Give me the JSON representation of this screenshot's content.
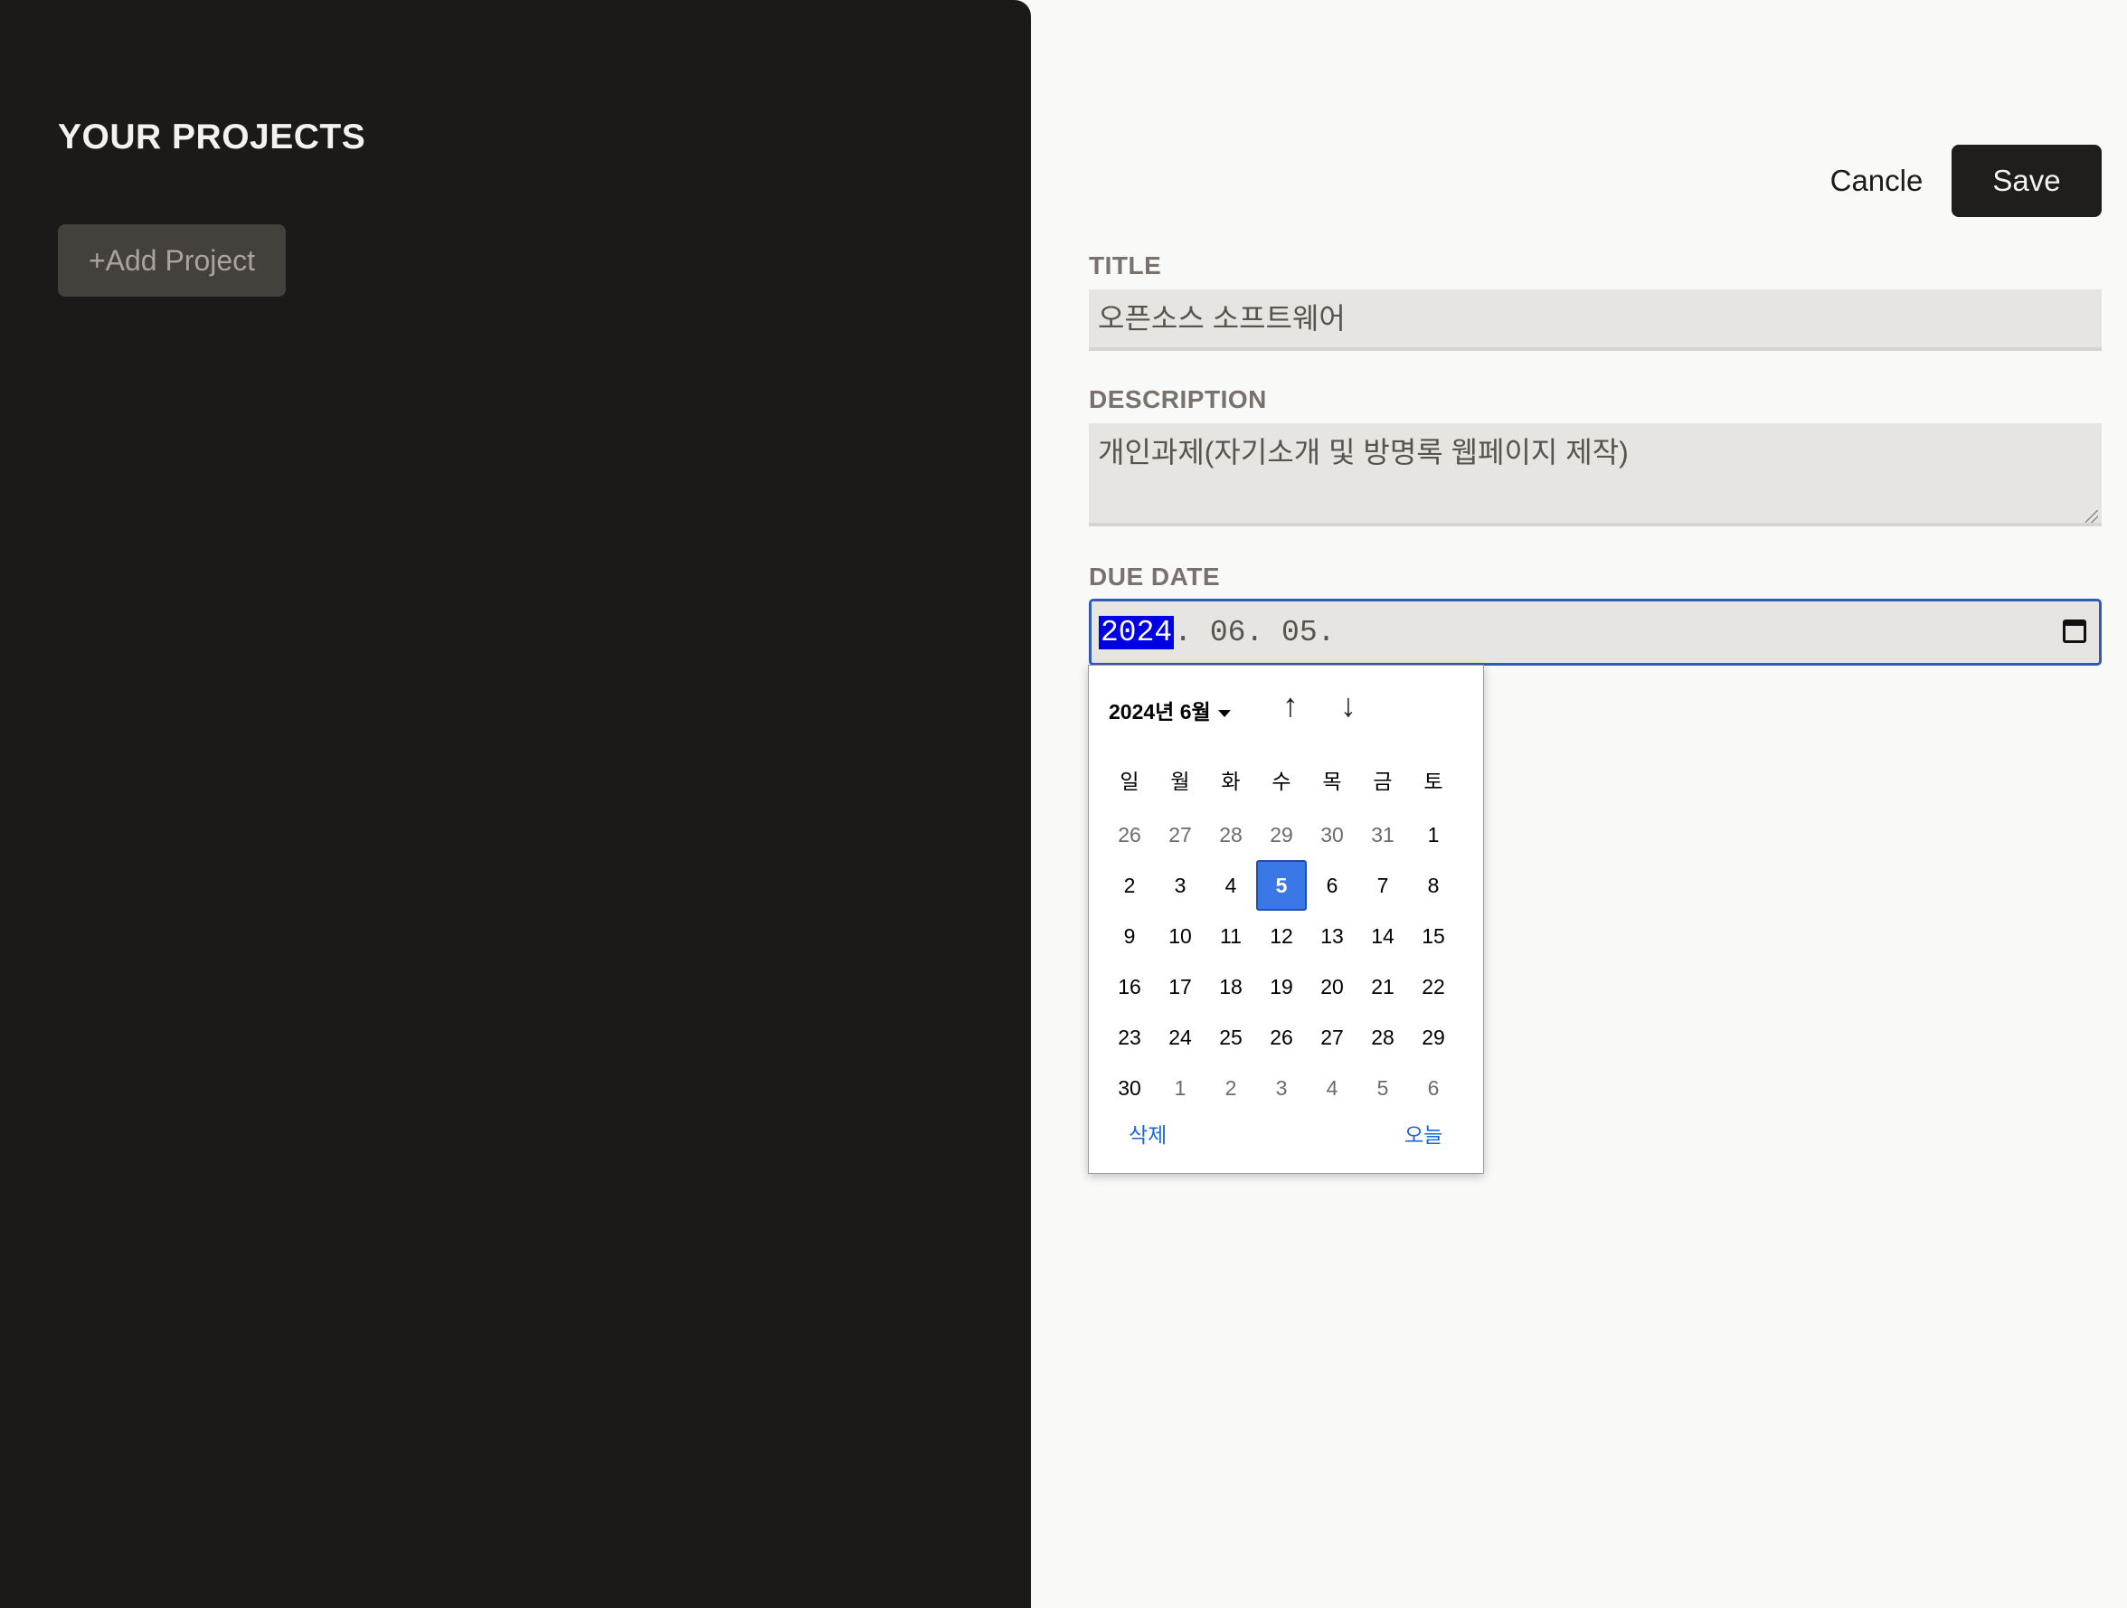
{
  "sidebar": {
    "title": "YOUR PROJECTS",
    "add_button": "+Add Project"
  },
  "actions": {
    "cancel_label": "Cancle",
    "save_label": "Save"
  },
  "form": {
    "title_label": "TITLE",
    "title_value": "오픈소스 소프트웨어",
    "description_label": "DESCRIPTION",
    "description_value": "개인과제(자기소개 및 방명록 웹페이지 제작)",
    "due_date_label": "DUE DATE",
    "due_date_year": "2024",
    "due_date_rest": ". 06. 05."
  },
  "calendar": {
    "month_label": "2024년 6월",
    "weekdays": [
      "일",
      "월",
      "화",
      "수",
      "목",
      "금",
      "토"
    ],
    "weeks": [
      [
        "26",
        "27",
        "28",
        "29",
        "30",
        "31",
        "1"
      ],
      [
        "2",
        "3",
        "4",
        "5",
        "6",
        "7",
        "8"
      ],
      [
        "9",
        "10",
        "11",
        "12",
        "13",
        "14",
        "15"
      ],
      [
        "16",
        "17",
        "18",
        "19",
        "20",
        "21",
        "22"
      ],
      [
        "23",
        "24",
        "25",
        "26",
        "27",
        "28",
        "29"
      ],
      [
        "30",
        "1",
        "2",
        "3",
        "4",
        "5",
        "6"
      ]
    ],
    "selected_day": "5",
    "clear_label": "삭제",
    "today_label": "오늘"
  },
  "colors": {
    "sidebar_bg": "#1b1a19",
    "accent": "#3a78e8",
    "link": "#1a66d6"
  }
}
